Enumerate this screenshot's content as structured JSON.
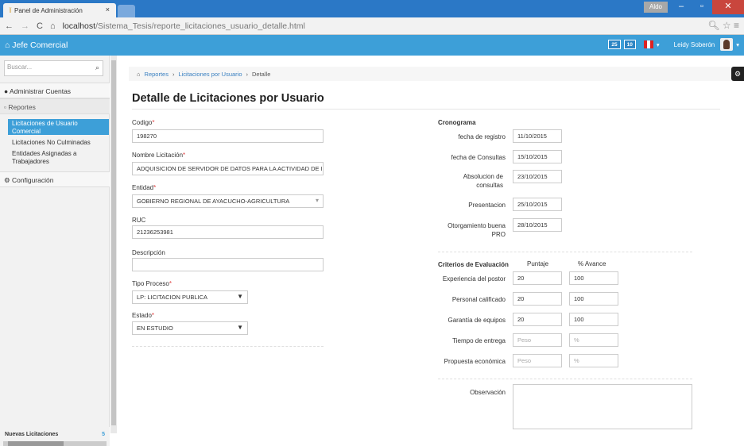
{
  "browser": {
    "tab_title": "Panel de Administración",
    "tab_close": "×",
    "user_chip": "Aldo",
    "url_host": "localhost",
    "url_path": "/Sistema_Tesis/reporte_licitaciones_usuario_detalle.html"
  },
  "topbar": {
    "brand": "Jefe Comercial",
    "badge1": "25",
    "badge2": "10",
    "user": "Leidy Soberón"
  },
  "sidebar": {
    "search_placeholder": "Buscar...",
    "sections": [
      "Administrar Cuentas",
      "Reportes",
      "Configuración"
    ],
    "items": [
      {
        "label": "Licitaciones de Usuario Comercial"
      },
      {
        "label": "Licitaciones No Culminadas"
      },
      {
        "label": "Entidades Asignadas a Trabajadores"
      }
    ],
    "footer_label": "Nuevas Licitaciones",
    "footer_count": "5"
  },
  "breadcrumb": [
    "Reportes",
    "Licitaciones por Usuario",
    "Detalle"
  ],
  "page_title": "Detalle de Licitaciones por Usuario",
  "form": {
    "codigo": {
      "label": "Codigo",
      "value": "198270"
    },
    "nombre": {
      "label": "Nombre Licitación",
      "value": "ADQUISICION DE SERVIDOR DE DATOS PARA LA ACTIVIDAD DE I"
    },
    "entidad": {
      "label": "Entidad",
      "value": "GOBIERNO REGIONAL DE AYACUCHO-AGRICULTURA"
    },
    "ruc": {
      "label": "RUC",
      "value": "21236253981"
    },
    "descripcion": {
      "label": "Descripción",
      "value": ""
    },
    "tipo": {
      "label": "Tipo Proceso",
      "value": "LP: LICITACION PUBLICA"
    },
    "estado": {
      "label": "Estado",
      "value": "EN ESTUDIO"
    },
    "required_mark": "*"
  },
  "cronograma": {
    "title": "Cronograma",
    "rows": [
      {
        "label": "fecha de registro",
        "value": "11/10/2015"
      },
      {
        "label": "fecha de Consultas",
        "value": "15/10/2015"
      },
      {
        "label": "Absolucion de consultas",
        "value": "23/10/2015"
      },
      {
        "label": "Presentacion",
        "value": "25/10/2015"
      },
      {
        "label": "Otorgamiento buena PRO",
        "value": "28/10/2015"
      }
    ]
  },
  "criterios": {
    "title": "Criterios de Evaluación",
    "col_puntaje": "Puntaje",
    "col_avance": "% Avance",
    "rows": [
      {
        "label": "Experiencia del postor",
        "puntaje": "20",
        "avance": "100"
      },
      {
        "label": "Personal calificado",
        "puntaje": "20",
        "avance": "100"
      },
      {
        "label": "Garantía de equipos",
        "puntaje": "20",
        "avance": "100"
      },
      {
        "label": "Tiempo de entrega",
        "puntaje": "",
        "avance": "",
        "ph_p": "Peso",
        "ph_a": "%"
      },
      {
        "label": "Propuesta económica",
        "puntaje": "",
        "avance": "",
        "ph_p": "Peso",
        "ph_a": "%"
      }
    ]
  },
  "observacion": {
    "label": "Observación"
  }
}
